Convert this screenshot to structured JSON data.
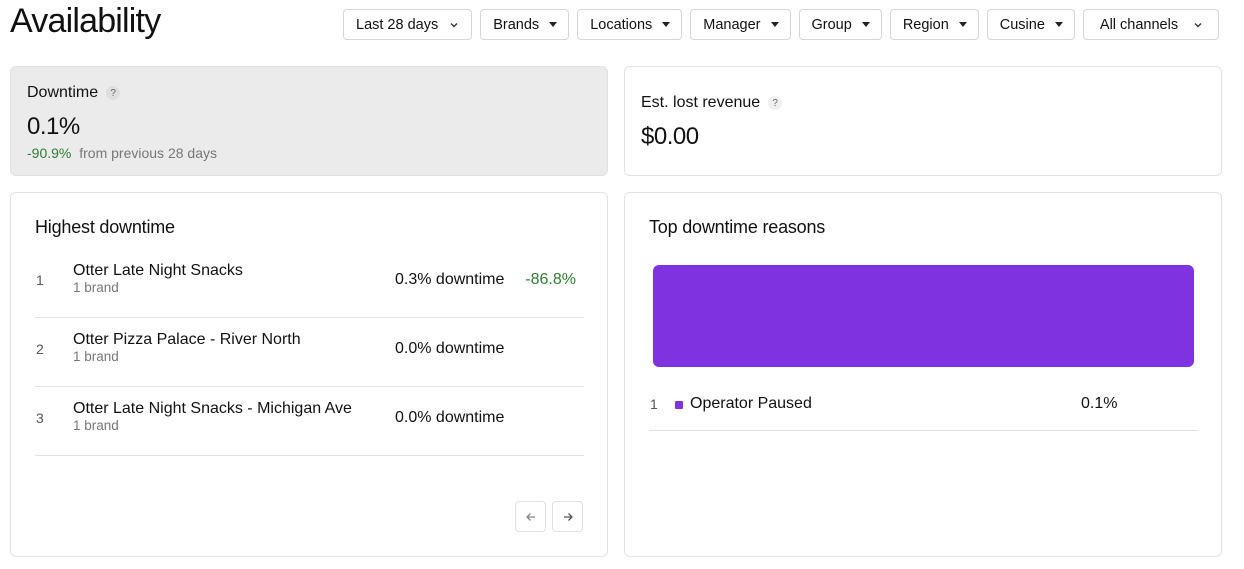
{
  "header": {
    "title": "Availability"
  },
  "filters": {
    "date_range": "Last 28 days",
    "brands": "Brands",
    "locations": "Locations",
    "manager": "Manager",
    "group": "Group",
    "region": "Region",
    "cuisine": "Cusine",
    "channels": "All channels"
  },
  "downtime": {
    "label": "Downtime",
    "value": "0.1%",
    "delta": "-90.9%",
    "delta_suffix": "from previous 28 days",
    "help": "?"
  },
  "revenue": {
    "label": "Est. lost revenue",
    "value": "$0.00",
    "help": "?"
  },
  "highest_downtime": {
    "title": "Highest downtime",
    "rows": [
      {
        "rank": "1",
        "name": "Otter Late Night Snacks",
        "sub": "1 brand",
        "pct": "0.3% downtime",
        "delta": "-86.8%"
      },
      {
        "rank": "2",
        "name": "Otter Pizza Palace - River North",
        "sub": "1 brand",
        "pct": "0.0% downtime",
        "delta": ""
      },
      {
        "rank": "3",
        "name": "Otter Late Night Snacks - Michigan Ave",
        "sub": "1 brand",
        "pct": "0.0% downtime",
        "delta": ""
      }
    ]
  },
  "top_reasons": {
    "title": "Top downtime reasons",
    "bar_color": "#7f32df",
    "rows": [
      {
        "rank": "1",
        "name": "Operator Paused",
        "pct": "0.1%",
        "share": 1.0
      }
    ]
  },
  "colors": {
    "accent": "#7f32df",
    "positive": "#2e7d32",
    "card_active": "#ebebeb"
  },
  "icons": {
    "caret": "caret-down-icon",
    "chevron": "chevron-down-icon",
    "help": "help-icon",
    "prev": "arrow-left-icon",
    "next": "arrow-right-icon"
  }
}
